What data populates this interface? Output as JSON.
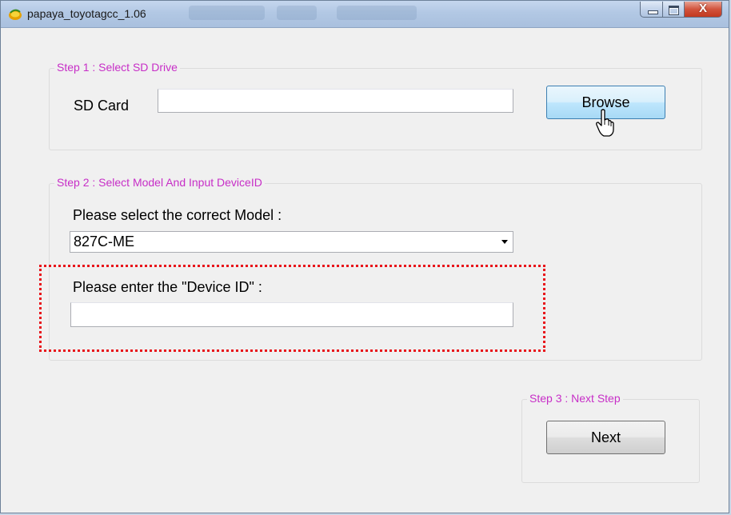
{
  "window": {
    "title": "papaya_toyotagcc_1.06",
    "icon": "papaya-app-icon",
    "controls": {
      "minimize": "minimize-icon",
      "maximize": "maximize-icon",
      "close_glyph": "X"
    }
  },
  "step1": {
    "legend": "Step 1 : Select SD Drive",
    "sd_label": "SD Card",
    "sd_value": "",
    "browse_label": "Browse"
  },
  "step2": {
    "legend": "Step 2 : Select Model And Input DeviceID",
    "model_prompt": "Please select the correct Model :",
    "model_selected": "827C-ME",
    "device_prompt": "Please enter the \"Device ID\" :",
    "device_value": ""
  },
  "step3": {
    "legend": "Step 3 : Next Step",
    "next_label": "Next"
  },
  "colors": {
    "legend": "#c72ec7",
    "highlight": "#e8141a",
    "hover_button": "#bee6fd"
  }
}
